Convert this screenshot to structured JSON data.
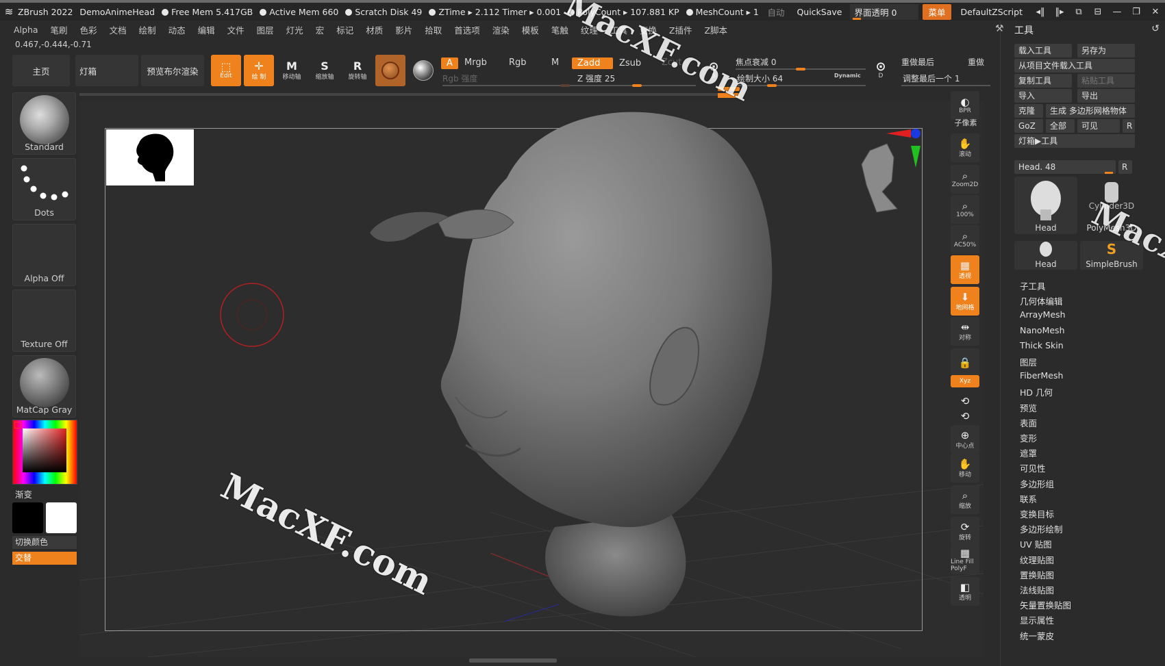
{
  "titlebar": {
    "app": "ZBrush 2022",
    "document": "DemoAnimeHead",
    "free_mem": "Free Mem 5.417GB",
    "active_mem": "Active Mem 660",
    "scratch": "Scratch Disk 49",
    "ztime": "ZTime ▸ 2.112 Timer ▸ 0.001",
    "polycount": "PolyCount ▸ 107.881 KP",
    "meshcount": "MeshCount ▸ 1",
    "auto": "自动",
    "quicksave": "QuickSave",
    "transparency": "界面透明 0",
    "menu": "菜单",
    "script": "DefaultZScript"
  },
  "menubar": [
    "Alpha",
    "笔刷",
    "色彩",
    "文档",
    "绘制",
    "动态",
    "编辑",
    "文件",
    "图层",
    "灯光",
    "宏",
    "标记",
    "材质",
    "影片",
    "拾取",
    "首选项",
    "渲染",
    "模板",
    "笔触",
    "纹理",
    "工具",
    "变换",
    "Z插件",
    "Z脚本"
  ],
  "coords": "0.467,-0.444,-0.71",
  "toolbar": {
    "home": "主页",
    "lightbox": "灯箱",
    "bpr": "预览布尔渲染",
    "edit": "Edit",
    "draw": "绘 制",
    "move": "移动轴",
    "scale": "缩放轴",
    "rotate": "旋转轴",
    "a": "A",
    "mrgb": "Mrgb",
    "rgb": "Rgb",
    "m": "M",
    "rgb_intensity": "Rgb 强度",
    "zadd": "Zadd",
    "zsub": "Zsub",
    "zcut": "Zcut",
    "z_intensity": "Z 强度 25",
    "focal": "焦点衰减 0",
    "draw_size": "绘制大小 64",
    "dynamic": "Dynamic",
    "s_label": "S",
    "d_label": "D",
    "redo_last": "重做最后",
    "redo": "重做",
    "adjust_last": "调整最后一个 1"
  },
  "leftpal": {
    "brush": "Standard",
    "stroke": "Dots",
    "alpha": "Alpha Off",
    "texture": "Texture Off",
    "material": "MatCap Gray",
    "gradient": "渐变",
    "switch_color": "切换颜色",
    "alternate": "交替"
  },
  "rshelf": [
    "BPR",
    "子像素",
    "滚动",
    "Zoom2D",
    "100%",
    "AC50%",
    "透视",
    "地网格",
    "对称",
    "",
    "Xyz",
    "",
    "",
    "中心点",
    "移动",
    "缩放",
    "旋转",
    "Line Fill PolyF",
    "透明"
  ],
  "toolpanel": {
    "title": "工具",
    "buttons": [
      "载入工具",
      "另存为",
      "从项目文件载入工具",
      "复制工具",
      "粘贴工具",
      "导入",
      "导出",
      "克隆",
      "生成 多边形网格物体",
      "GoZ",
      "全部",
      "可见",
      "R",
      "灯箱▶工具",
      "R"
    ],
    "head_slider": "Head. 48",
    "tiles": [
      "Head",
      "Cylinder3D",
      "PolyMesh3D",
      "Head",
      "SimpleBrush"
    ],
    "list": [
      "子工具",
      "几何体编辑",
      "ArrayMesh",
      "NanoMesh",
      "Thick Skin",
      "图层",
      "FiberMesh",
      "HD 几何",
      "预览",
      "表面",
      "变形",
      "遮罩",
      "可见性",
      "多边形组",
      "联系",
      "变换目标",
      "多边形绘制",
      "UV 贴图",
      "纹理贴图",
      "置换贴图",
      "法线贴图",
      "矢量置换贴图",
      "显示属性",
      "统一蒙皮"
    ]
  },
  "watermark": "MacXF.com",
  "colors": {
    "accent": "#f0821e",
    "bg": "#2b2b2b",
    "panel": "#353535"
  }
}
